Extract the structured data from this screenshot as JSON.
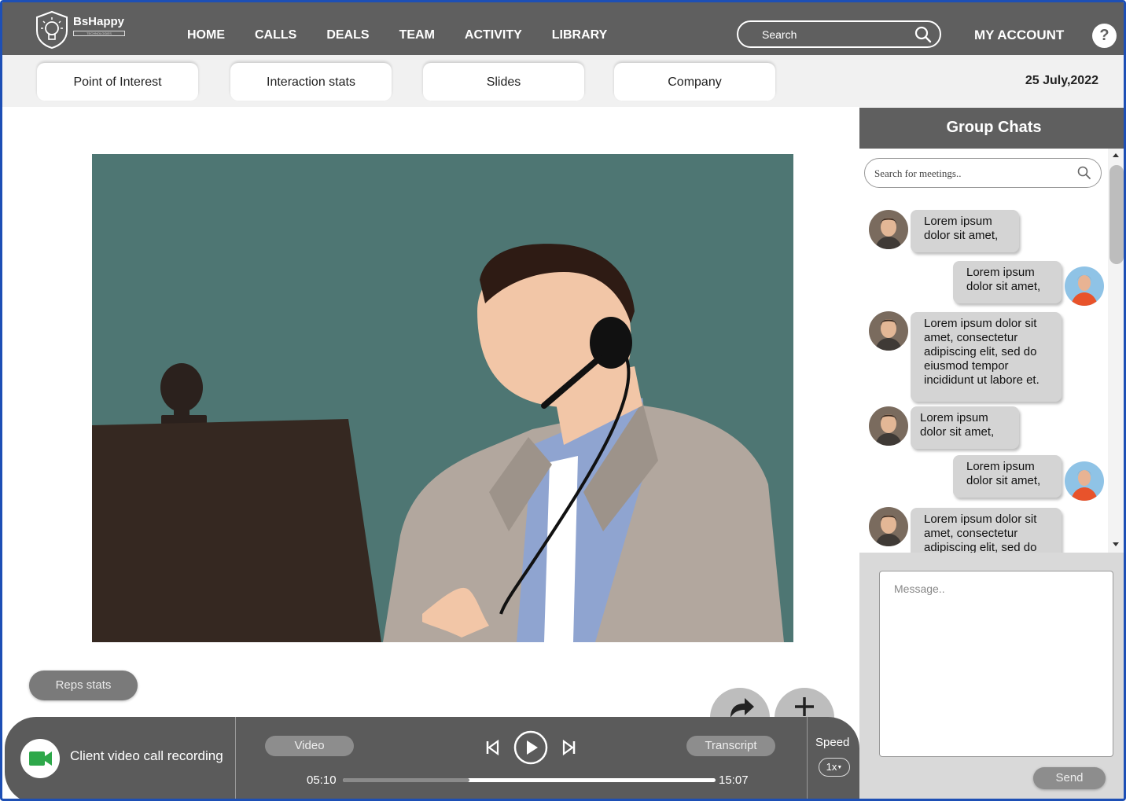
{
  "brand": {
    "name": "BsHappy",
    "tagline": "TECHNOLOGIES"
  },
  "nav": {
    "items": [
      {
        "label": "HOME"
      },
      {
        "label": "CALLS"
      },
      {
        "label": "DEALS"
      },
      {
        "label": "TEAM"
      },
      {
        "label": "ACTIVITY"
      },
      {
        "label": "LIBRARY"
      }
    ],
    "search_placeholder": "Search",
    "account_label": "MY ACCOUNT",
    "help_label": "?"
  },
  "tabs": [
    {
      "label": "Point of Interest"
    },
    {
      "label": "Interaction stats"
    },
    {
      "label": "Slides"
    },
    {
      "label": "Company"
    }
  ],
  "date": "25 July,2022",
  "reps_stats_label": "Reps stats",
  "player": {
    "recording_label": "Client video call recording",
    "video_label": "Video",
    "transcript_label": "Transcript",
    "current_time": "05:10",
    "total_time": "15:07",
    "progress_fraction": 0.34,
    "speed_label": "Speed",
    "speed_value": "1x"
  },
  "chat": {
    "title": "Group Chats",
    "search_placeholder": "Search for meetings..",
    "messages": [
      {
        "sender": "man",
        "side": "left",
        "text": "Lorem ipsum dolor sit amet,"
      },
      {
        "sender": "woman",
        "side": "right",
        "text": "Lorem ipsum dolor sit amet,"
      },
      {
        "sender": "man",
        "side": "left",
        "text": "Lorem ipsum dolor sit amet, consectetur adipiscing elit, sed do eiusmod tempor incididunt ut labore et."
      },
      {
        "sender": "man",
        "side": "left",
        "text": "Lorem ipsum dolor sit amet,"
      },
      {
        "sender": "woman",
        "side": "right",
        "text": "Lorem ipsum dolor sit amet,"
      },
      {
        "sender": "man",
        "side": "left",
        "text": "Lorem ipsum dolor sit amet, consectetur adipiscing elit, sed do"
      }
    ],
    "message_placeholder": "Message..",
    "send_label": "Send"
  },
  "colors": {
    "nav_bg": "#5f5f5f",
    "video_bg": "#4e7673",
    "sidebar_bg": "#d9d9d9",
    "camera_green": "#2ea84a"
  },
  "icons": {
    "logo": "lightbulb-shield-icon",
    "search": "search-icon",
    "help": "question-icon",
    "share": "share-arrow-icon",
    "add": "plus-icon",
    "camera": "video-camera-icon",
    "prev": "skip-previous-icon",
    "play": "play-icon",
    "next": "skip-next-icon"
  }
}
